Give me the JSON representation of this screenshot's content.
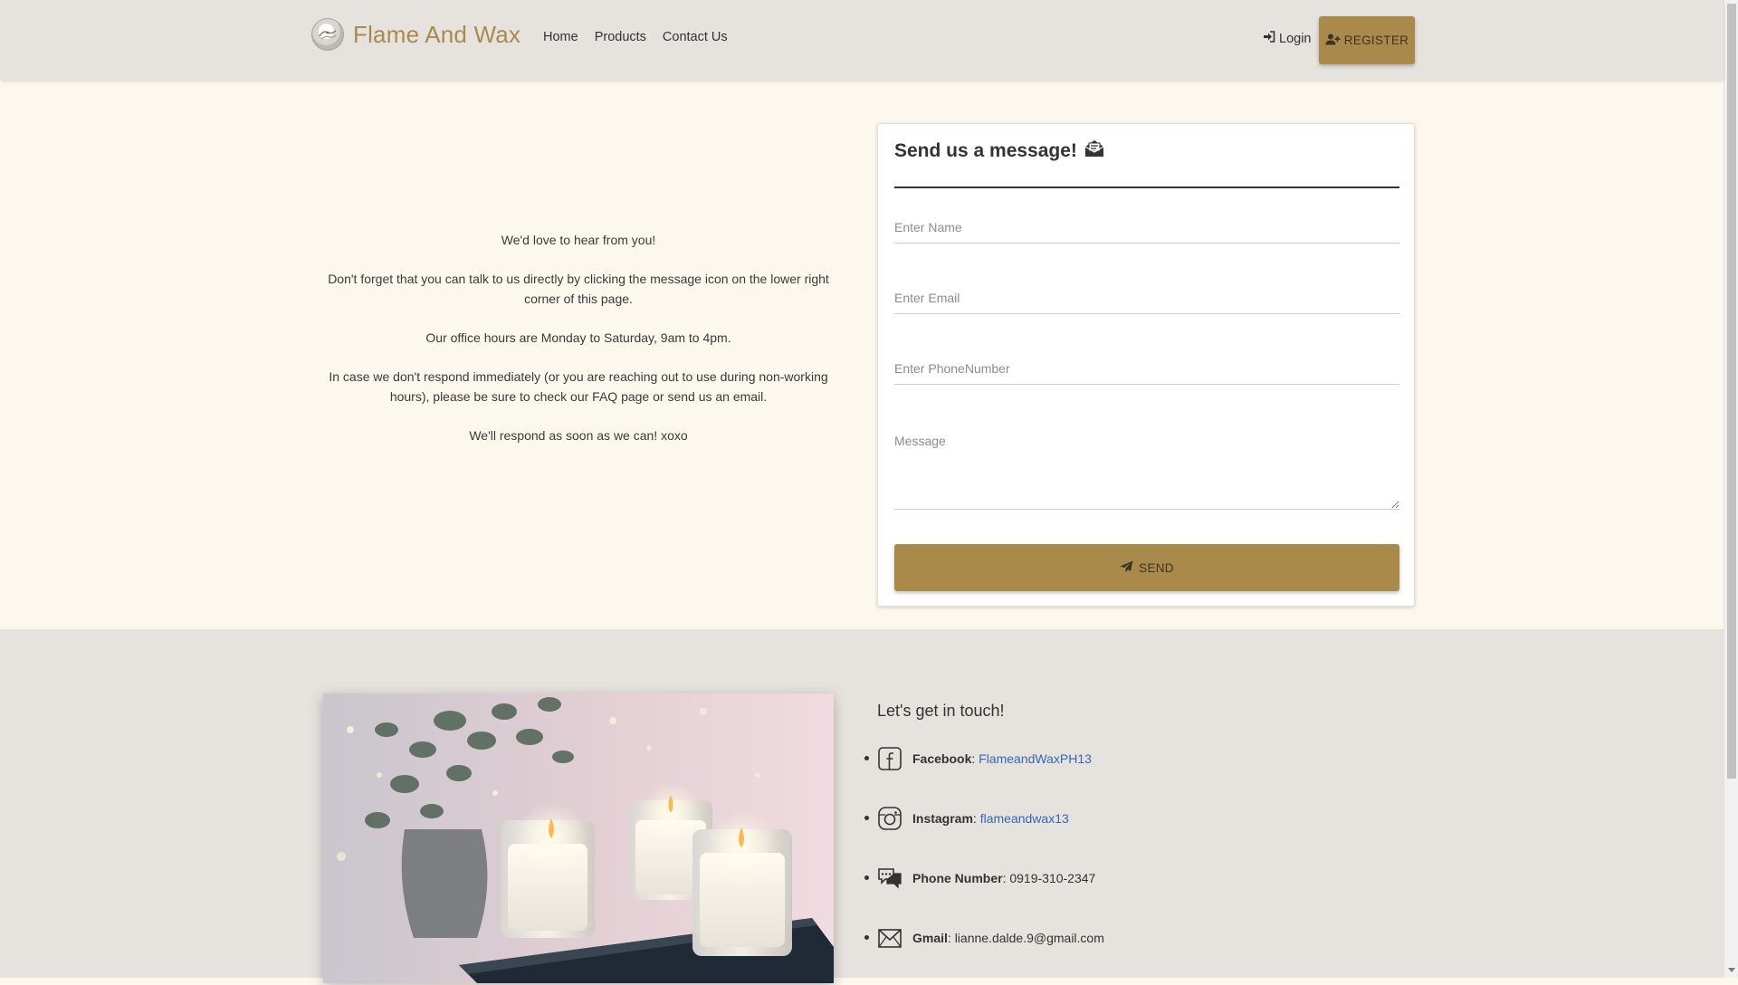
{
  "header": {
    "brand_name": "Flame And Wax",
    "nav": [
      "Home",
      "Products",
      "Contact Us"
    ],
    "login_label": "Login",
    "register_label": "REGISTER"
  },
  "intro": {
    "paragraphs": [
      "We'd love to hear from you!",
      "Don't forget that you can talk to us directly by clicking the message icon on the lower right corner of this page.",
      "Our office hours are Monday to Saturday, 9am to 4pm.",
      "In case we don't respond immediately (or you are reaching out to use during non-working hours), please be sure to check our FAQ page or send us an email.",
      "We'll respond as soon as we can! xoxo"
    ]
  },
  "form": {
    "title": "Send us a message!",
    "name_placeholder": "Enter Name",
    "email_placeholder": "Enter Email",
    "phone_placeholder": "Enter PhoneNumber",
    "message_placeholder": "Message",
    "send_label": "SEND"
  },
  "touch": {
    "heading": "Let's get in touch!",
    "items": [
      {
        "icon": "facebook-icon",
        "label": "Facebook",
        "value": "FlameandWaxPH13",
        "is_link": true
      },
      {
        "icon": "instagram-icon",
        "label": "Instagram",
        "value": "flameandwax13",
        "is_link": true
      },
      {
        "icon": "chat-bubbles-icon",
        "label": "Phone Number",
        "value": "0919-310-2347",
        "is_link": false
      },
      {
        "icon": "mail-icon",
        "label": "Gmail",
        "value": "lianne.dalde.9@gmail.com",
        "is_link": false
      }
    ]
  },
  "colors": {
    "accent": "#a98a4b",
    "navbar_bg": "#e6e3de",
    "page_bg": "#fdf8ee",
    "link": "#3567b7"
  }
}
